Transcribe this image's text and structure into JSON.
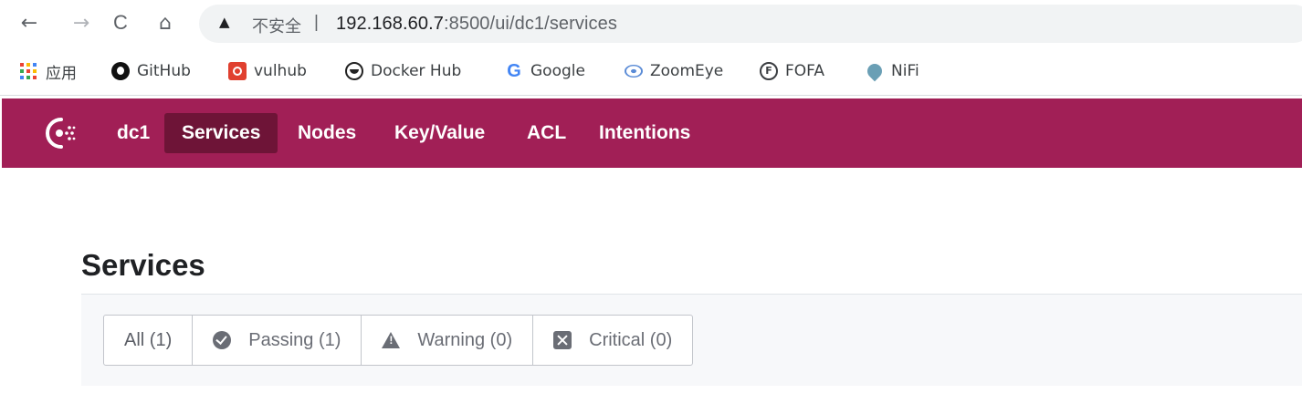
{
  "browser": {
    "back_glyph": "←",
    "forward_glyph": "→",
    "reload_glyph": "C",
    "home_glyph": "⌂",
    "warning_glyph": "▲",
    "insecure_label": "不安全",
    "separator": "|",
    "url_host": "192.168.60.7",
    "url_rest": ":8500/ui/dc1/services"
  },
  "bookmarks": [
    {
      "label": "应用",
      "icon": "apps-grid-icon"
    },
    {
      "label": "GitHub",
      "icon": "github-icon"
    },
    {
      "label": "vulhub",
      "icon": "vulhub-icon"
    },
    {
      "label": "Docker Hub",
      "icon": "docker-icon"
    },
    {
      "label": "Google",
      "icon": "google-icon",
      "glyph": "G"
    },
    {
      "label": "ZoomEye",
      "icon": "zoomeye-icon"
    },
    {
      "label": "FOFA",
      "icon": "fofa-icon",
      "glyph": "F"
    },
    {
      "label": "NiFi",
      "icon": "nifi-icon"
    }
  ],
  "consul_nav": {
    "datacenter": "dc1",
    "items": [
      "Services",
      "Nodes",
      "Key/Value",
      "ACL",
      "Intentions"
    ],
    "active": "Services",
    "color_primary": "#a11f56",
    "color_active": "#6e1437"
  },
  "page": {
    "title": "Services",
    "filters": [
      {
        "label": "All (1)",
        "icon": ""
      },
      {
        "label": "Passing (1)",
        "icon": "check-circle-icon"
      },
      {
        "label": "Warning (0)",
        "icon": "warning-triangle-icon"
      },
      {
        "label": "Critical (0)",
        "icon": "x-square-icon"
      }
    ]
  }
}
